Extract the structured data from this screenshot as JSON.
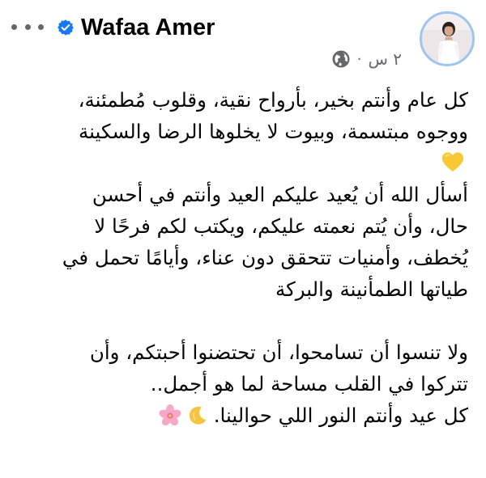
{
  "post": {
    "author": {
      "name": "Wafaa Amer",
      "verified": true
    },
    "timestamp": "٢ س",
    "separator": "·",
    "privacy_icon": "globe-icon",
    "menu_icon": "more-horizontal-icon",
    "text": {
      "para1": [
        "كل عام وأنتم بخير، بأرواح نقية، وقلوب مُطمئنة،",
        "ووجوه مبتسمة، وبيوت لا يخلوها الرضا والسكينة"
      ],
      "para1_emoji": "yellow-heart-icon",
      "para2": [
        "أسأل الله أن يُعيد عليكم العيد وأنتم في أحسن",
        "حال، وأن يُتم نعمته عليكم، ويكتب لكم فرحًا لا",
        "يُخطف، وأمنيات تتحقق دون عناء، وأيامًا تحمل في",
        "طياتها الطمأنينة والبركة"
      ],
      "para3": [
        "ولا تنسوا أن تسامحوا، أن تحتضنوا أحبتكم، وأن",
        "تتركوا في القلب مساحة لما هو أجمل..",
        "كل عيد وأنتم النور اللي حوالينا."
      ],
      "last_line_emojis": [
        "crescent-moon-icon",
        "cherry-blossom-icon"
      ]
    },
    "colors": {
      "text": "#050505",
      "secondary": "#65676b",
      "verified": "#1877f2",
      "avatar_ring": "#9fc4f0",
      "heart": "#f7c935",
      "moon": "#f5c542",
      "blossom": "#f7a8c4"
    }
  }
}
